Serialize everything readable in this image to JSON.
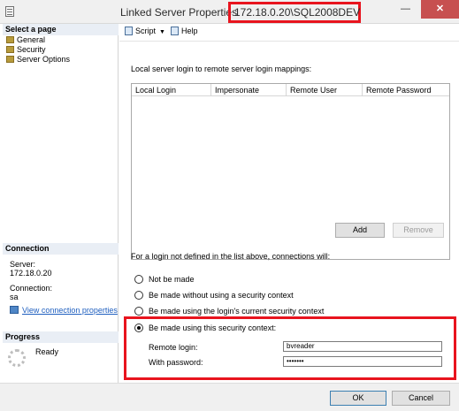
{
  "window": {
    "title": "Linked Server Properties",
    "server": "172.18.0.20\\SQL2008DEV",
    "minimize_glyph": "—",
    "close_glyph": "✕"
  },
  "left": {
    "select_page_header": "Select a page",
    "pages": [
      "General",
      "Security",
      "Server Options"
    ],
    "connection_header": "Connection",
    "server_label": "Server:",
    "server_value": "172.18.0.20",
    "connection_label": "Connection:",
    "connection_value": "sa",
    "view_link": "View connection properties",
    "progress_header": "Progress",
    "progress_status": "Ready"
  },
  "toolbar": {
    "script_label": "Script",
    "help_label": "Help"
  },
  "main": {
    "mappings_label": "Local server login to remote server login mappings:",
    "columns": [
      "Local Login",
      "Impersonate",
      "Remote User",
      "Remote Password"
    ],
    "add_label": "Add",
    "remove_label": "Remove",
    "not_defined_label": "For a login not defined in the list above, connections will:",
    "options": [
      "Not be made",
      "Be made without using a security context",
      "Be made using the login's current security context",
      "Be made using this security context:"
    ],
    "selected_option": 3,
    "remote_login_label": "Remote login:",
    "remote_login_value": "bvreader",
    "password_label": "With password:",
    "password_value": "•••••••"
  },
  "footer": {
    "ok_label": "OK",
    "cancel_label": "Cancel"
  },
  "colors": {
    "highlight": "#e8141e",
    "section_header_bg": "#e9eef5",
    "link": "#1f5fbf"
  }
}
